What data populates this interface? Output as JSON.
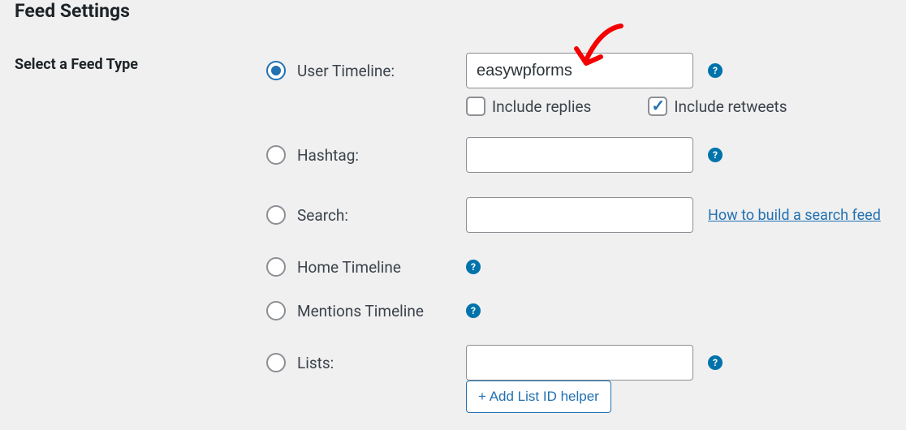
{
  "page_title": "Feed Settings",
  "section_label": "Select a Feed Type",
  "feed": {
    "user_timeline": {
      "label": "User Timeline:",
      "value": "easywpforms",
      "selected": true
    },
    "include_replies": {
      "label": "Include replies",
      "checked": false
    },
    "include_retweets": {
      "label": "Include retweets",
      "checked": true
    },
    "hashtag": {
      "label": "Hashtag:",
      "value": ""
    },
    "search": {
      "label": "Search:",
      "value": "",
      "help_link": "How to build a search feed"
    },
    "home_timeline": {
      "label": "Home Timeline"
    },
    "mentions_timeline": {
      "label": "Mentions Timeline"
    },
    "lists": {
      "label": "Lists:",
      "value": "",
      "button": "+ Add List ID helper"
    }
  },
  "help_glyph": "?"
}
